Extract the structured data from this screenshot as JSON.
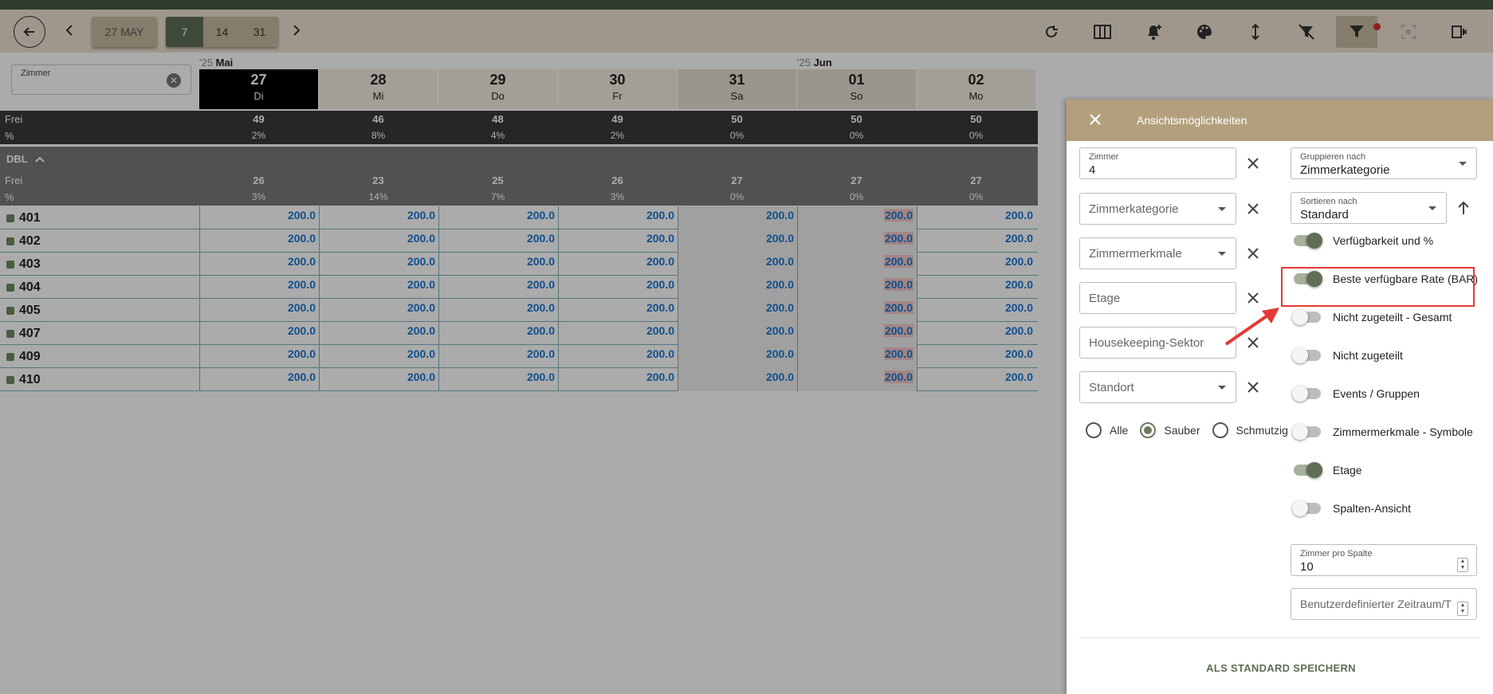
{
  "toolbar": {
    "date_label": "27 MAY",
    "ranges": [
      "7",
      "14",
      "31"
    ],
    "active_range": "7"
  },
  "grid": {
    "room_filter_label": "Zimmer",
    "months": [
      {
        "year": "'25",
        "name": "Mai"
      },
      {
        "year": "'25",
        "name": "Jun"
      }
    ],
    "days": [
      {
        "num": "27",
        "wd": "Di"
      },
      {
        "num": "28",
        "wd": "Mi"
      },
      {
        "num": "29",
        "wd": "Do"
      },
      {
        "num": "30",
        "wd": "Fr"
      },
      {
        "num": "31",
        "wd": "Sa"
      },
      {
        "num": "01",
        "wd": "So"
      },
      {
        "num": "02",
        "wd": "Mo"
      }
    ],
    "total": {
      "free_label": "Frei",
      "pct_label": "%",
      "free": [
        "49",
        "46",
        "48",
        "49",
        "50",
        "50",
        "50"
      ],
      "pct": [
        "2%",
        "8%",
        "4%",
        "2%",
        "0%",
        "0%",
        "0%"
      ]
    },
    "group": {
      "name": "DBL",
      "free_label": "Frei",
      "pct_label": "%",
      "free": [
        "26",
        "23",
        "25",
        "26",
        "27",
        "27",
        "27"
      ],
      "pct": [
        "3%",
        "14%",
        "7%",
        "3%",
        "0%",
        "0%",
        "0%"
      ]
    },
    "rooms": [
      "401",
      "402",
      "403",
      "404",
      "405",
      "407",
      "409",
      "410"
    ],
    "rate": "200.0"
  },
  "panel": {
    "title": "Ansichtsmöglichkeiten",
    "zimmer_label": "Zimmer",
    "zimmer_value": "4",
    "zimmerkategorie": "Zimmerkategorie",
    "zimmermerkmale": "Zimmermerkmale",
    "etage": "Etage",
    "housekeeping": "Housekeeping-Sektor",
    "standort": "Standort",
    "radios": [
      "Alle",
      "Sauber",
      "Schmutzig"
    ],
    "gruppieren_label": "Gruppieren nach",
    "gruppieren_value": "Zimmerkategorie",
    "sortieren_label": "Sortieren nach",
    "sortieren_value": "Standard",
    "toggles": [
      {
        "label": "Verfügbarkeit und %",
        "on": true
      },
      {
        "label": "Beste verfügbare Rate (BAR)",
        "on": true
      },
      {
        "label": "Nicht zugeteilt - Gesamt",
        "on": false
      },
      {
        "label": "Nicht zugeteilt",
        "on": false
      },
      {
        "label": "Events / Gruppen",
        "on": false
      },
      {
        "label": "Zimmermerkmale - Symbole",
        "on": false
      },
      {
        "label": "Etage",
        "on": true
      },
      {
        "label": "Spalten-Ansicht",
        "on": false
      }
    ],
    "zimmer_pro_spalte_label": "Zimmer pro Spalte",
    "zimmer_pro_spalte_value": "10",
    "custom_range_placeholder": "Benutzerdefinierter Zeitraum/T",
    "save_label": "ALS STANDARD SPEICHERN"
  },
  "colors": {
    "accent": "#5f6e55",
    "header": "#b39f7c",
    "rate": "#1976d2",
    "highlight": "#e53935"
  }
}
